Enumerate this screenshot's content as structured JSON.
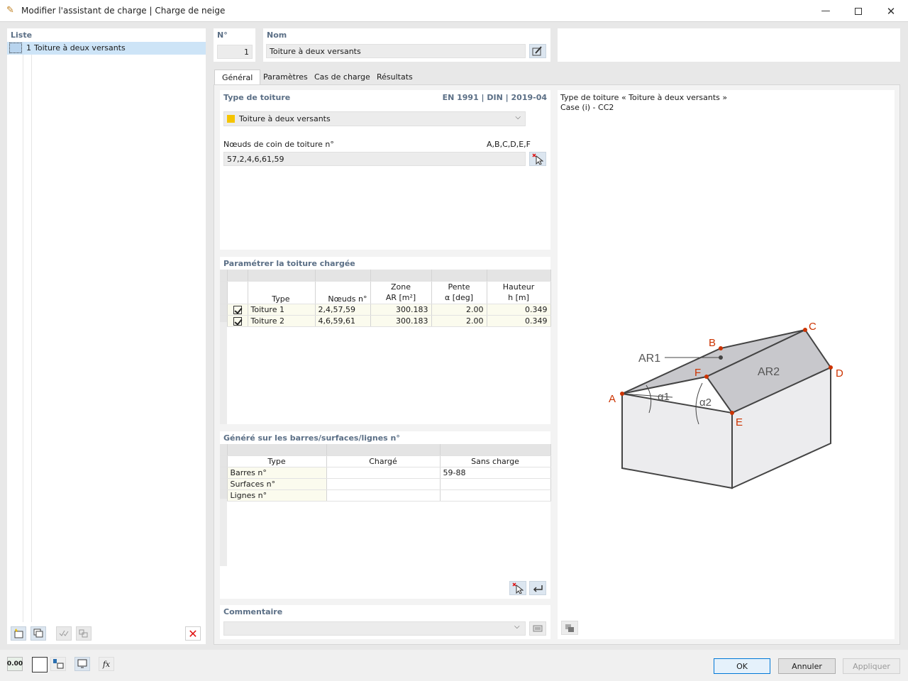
{
  "window": {
    "title": "Modifier l'assistant de charge | Charge de neige"
  },
  "list": {
    "header": "Liste",
    "items": [
      {
        "num": "1",
        "label": "Toiture à deux versants"
      }
    ]
  },
  "number": {
    "label": "N°",
    "value": "1"
  },
  "name": {
    "label": "Nom",
    "value": "Toiture à deux versants"
  },
  "tabs": [
    "Général",
    "Paramètres",
    "Cas de charge",
    "Résultats"
  ],
  "roof_type": {
    "title": "Type de toiture",
    "norm": "EN 1991 | DIN | 2019-04",
    "selected": "Toiture à deux versants",
    "swatch_color": "#f5c400",
    "corner_label": "Nœuds de coin de toiture n°",
    "corner_letters": "A,B,C,D,E,F",
    "corner_value": "57,2,4,6,61,59"
  },
  "loaded_roof": {
    "title": "Paramétrer la toiture chargée",
    "headers": {
      "type": "Type",
      "nodes": "Nœuds n°",
      "zone1": "Zone",
      "zone2": "AR [m²]",
      "slope1": "Pente",
      "slope2": "α [deg]",
      "height1": "Hauteur",
      "height2": "h [m]"
    },
    "rows": [
      {
        "type": "Toiture 1",
        "nodes": "2,4,57,59",
        "area": "300.183",
        "slope": "2.00",
        "height": "0.349"
      },
      {
        "type": "Toiture 2",
        "nodes": "4,6,59,61",
        "area": "300.183",
        "slope": "2.00",
        "height": "0.349"
      }
    ]
  },
  "generated": {
    "title": "Généré sur les barres/surfaces/lignes n°",
    "headers": {
      "type": "Type",
      "loaded": "Chargé",
      "unloaded": "Sans charge"
    },
    "rows": [
      {
        "type": "Barres n°",
        "loaded": "",
        "unloaded": "59-88"
      },
      {
        "type": "Surfaces n°",
        "loaded": "",
        "unloaded": ""
      },
      {
        "type": "Lignes n°",
        "loaded": "",
        "unloaded": ""
      }
    ]
  },
  "comment": {
    "title": "Commentaire",
    "value": ""
  },
  "preview": {
    "line1": "Type de toiture « Toiture à deux versants »",
    "line2": "Case (i) - CC2",
    "labels": {
      "A": "A",
      "B": "B",
      "C": "C",
      "D": "D",
      "E": "E",
      "F": "F",
      "ar1": "AR1",
      "ar2": "AR2",
      "a1": "α1",
      "a2": "α2"
    },
    "accent": "#cc3300"
  },
  "footer": {
    "ok": "OK",
    "cancel": "Annuler",
    "apply": "Appliquer",
    "units_icon": "0.00"
  }
}
